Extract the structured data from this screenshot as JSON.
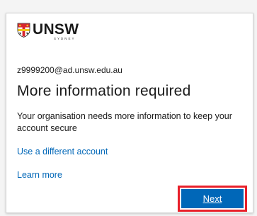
{
  "brand": {
    "name": "UNSW",
    "sub": "SYDNEY",
    "crest": "unsw-crest-icon"
  },
  "account": {
    "email": "z9999200@ad.unsw.edu.au"
  },
  "content": {
    "title": "More information required",
    "description": "Your organisation needs more information to keep your account secure"
  },
  "links": {
    "different_account": "Use a different account",
    "learn_more": "Learn more"
  },
  "actions": {
    "next_label": "Next"
  },
  "colors": {
    "accent": "#0067b8",
    "highlight": "#e8202a"
  }
}
